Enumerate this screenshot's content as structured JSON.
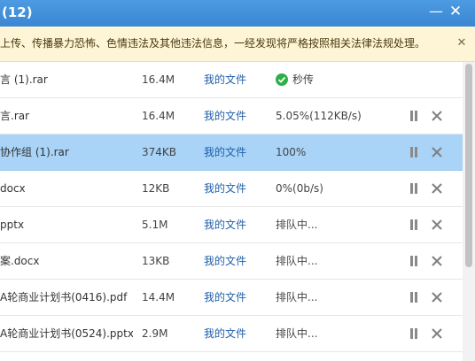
{
  "window": {
    "title": "(12)",
    "minimize_glyph": "—",
    "close_glyph": "✕"
  },
  "notice": {
    "text": "上传、传播暴力恐怖、色情违法及其他违法信息，一经发现将严格按照相关法律法规处理。",
    "close_glyph": "✕"
  },
  "files": [
    {
      "name": "言 (1).rar",
      "size": "16.4M",
      "location": "我的文件",
      "status": "秒传",
      "status_icon": "check-circle-icon",
      "selected": false
    },
    {
      "name": "言.rar",
      "size": "16.4M",
      "location": "我的文件",
      "status": "5.05%(112KB/s)",
      "selected": false
    },
    {
      "name": "协作组 (1).rar",
      "size": "374KB",
      "location": "我的文件",
      "status": "100%",
      "selected": true
    },
    {
      "name": "docx",
      "size": "12KB",
      "location": "我的文件",
      "status": "0%(0b/s)",
      "selected": false
    },
    {
      "name": "pptx",
      "size": "5.1M",
      "location": "我的文件",
      "status": "排队中...",
      "selected": false
    },
    {
      "name": "案.docx",
      "size": "13KB",
      "location": "我的文件",
      "status": "排队中...",
      "selected": false
    },
    {
      "name": "A轮商业计划书(0416).pdf",
      "size": "14.4M",
      "location": "我的文件",
      "status": "排队中...",
      "selected": false
    },
    {
      "name": "A轮商业计划书(0524).pptx",
      "size": "2.9M",
      "location": "我的文件",
      "status": "排队中...",
      "selected": false
    }
  ],
  "colors": {
    "titlebar": "#3a86d3",
    "notice_bg": "#fdf5d6",
    "selected_row": "#a9d3f7",
    "link": "#1f5fa8",
    "success": "#2fae4a"
  }
}
